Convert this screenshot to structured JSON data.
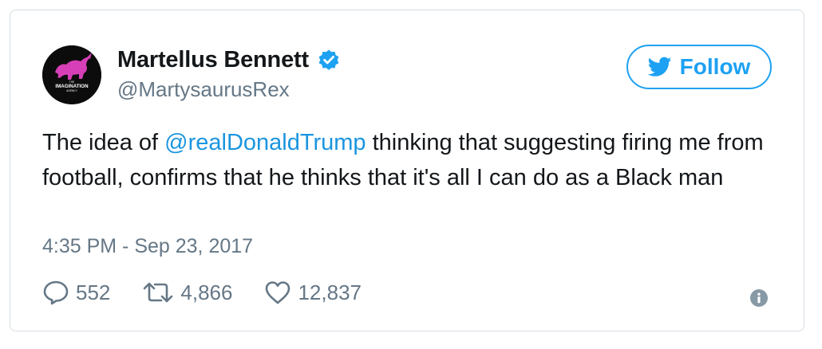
{
  "author": {
    "display_name": "Martellus Bennett",
    "handle": "@MartysaurusRex",
    "verified": true,
    "avatar_logo_text_top": "THE",
    "avatar_logo_text_main": "IMAGINATION",
    "avatar_logo_text_bottom": "AGENCY"
  },
  "follow_button": {
    "label": "Follow",
    "icon": "twitter-bird-icon"
  },
  "tweet": {
    "text_before": "The idea of ",
    "mention": "@realDonaldTrump",
    "text_after": " thinking that suggesting firing me from football, confirms that he thinks that it's all I can do as a Black man",
    "timestamp": "4:35 PM - Sep 23, 2017"
  },
  "actions": {
    "replies": "552",
    "retweets": "4,866",
    "likes": "12,837"
  },
  "colors": {
    "accent": "#1da1f2",
    "mention": "#1b95e0",
    "muted": "#657786",
    "text": "#14171a",
    "avatar_figure": "#d63fb7"
  }
}
